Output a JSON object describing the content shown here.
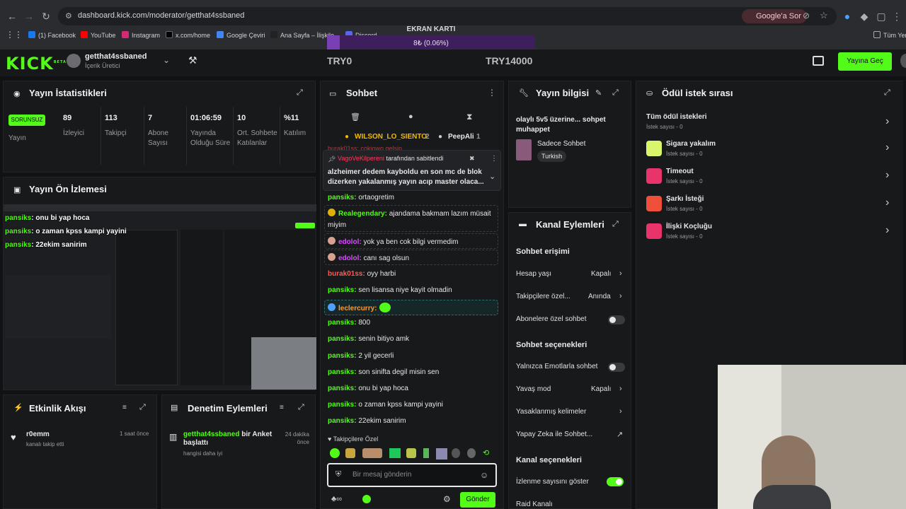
{
  "browser": {
    "url": "dashboard.kick.com/moderator/getthat4ssbaned",
    "google_chip": "Google'a Sor",
    "bookmarks": [
      "(1) Facebook",
      "YouTube",
      "Instagram",
      "x.com/home",
      "Google Çeviri",
      "Ana Sayfa – İlişkile...",
      "Discord",
      "Tüm Yer"
    ]
  },
  "overlay": {
    "card_title": "EKRAN KARTI",
    "progress_text": "8₺ (0.06%)",
    "progress_fraction": 0.0006,
    "left_amount": "TRY0",
    "right_amount": "TRY14000"
  },
  "header": {
    "logo": "KICK",
    "logo_beta": "BETA",
    "username": "getthat4ssbaned",
    "role": "İçerik Üretici",
    "go_live": "Yayına Geç"
  },
  "stats": {
    "title": "Yayın İstatistikleri",
    "status_badge": "SORUNSUZ",
    "status_label": "Yayın",
    "items": [
      {
        "value": "89",
        "label": "İzleyici"
      },
      {
        "value": "113",
        "label": "Takipçi"
      },
      {
        "value": "7",
        "label": "Abone Sayısı"
      },
      {
        "value": "01:06:59",
        "label": "Yayında Olduğu Süre"
      },
      {
        "value": "10",
        "label": "Ort. Sohbete Katılanlar"
      },
      {
        "value": "%11",
        "label": "Katılım"
      }
    ]
  },
  "preview": {
    "title": "Yayın Ön İzlemesi",
    "overlay_lines": [
      {
        "user": "pansiks",
        "text": ": onu bi yap hoca"
      },
      {
        "user": "pansiks",
        "text": ": o zaman kpss kampi yayini"
      },
      {
        "user": "pansiks",
        "text": ": 22ekim sanirim"
      }
    ]
  },
  "activity": {
    "title": "Etkinlik Akışı",
    "item_user": "r0emm",
    "item_text": "kanalı takip etti",
    "item_time": "1 saat önce"
  },
  "moderation": {
    "title": "Denetim Eylemleri",
    "item_user": "getthat4ssbaned",
    "item_action": " bir Anket başlattı",
    "item_sub": "hangisi daha iyi",
    "item_time": "24 dakika önce"
  },
  "chat": {
    "title": "Sohbet",
    "top_users": [
      {
        "name": "WILSON_LO_SIENTO",
        "count": "2"
      },
      {
        "name": "PeepAli",
        "count": "1"
      }
    ],
    "pinned_by": "VagoVeKilpereni",
    "pinned_suffix": " tarafından sabitlendi",
    "pinned_text": "alzheimer dedem kayboldu en son mc de blok dizerken yakalanmış yayın acıp master olaca...",
    "cut_line": "burak01ss: cokiowo gelsin",
    "messages": [
      {
        "user": "pansiks",
        "text": " ortaogretim"
      },
      {
        "user": "Realegendary",
        "text": " ajandama bakmam lazım müsait miyim"
      },
      {
        "user": "edolol",
        "text": " yok ya ben cok bilgi vermedim"
      },
      {
        "user": "edolol",
        "text": " canı sag olsun"
      },
      {
        "user": "burak01ss",
        "text": " oyy harbi"
      },
      {
        "user": "pansiks",
        "text": " sen lisansa niye kayit olmadin"
      },
      {
        "user": "leclercurry",
        "text": ""
      },
      {
        "user": "pansiks",
        "text": " 800"
      },
      {
        "user": "pansiks",
        "text": " senin bitiyo amk"
      },
      {
        "user": "pansiks",
        "text": " 2 yil gecerli"
      },
      {
        "user": "pansiks",
        "text": " son sinifta degil misin sen"
      },
      {
        "user": "pansiks",
        "text": " onu bi yap hoca"
      },
      {
        "user": "pansiks",
        "text": " o zaman kpss kampi yayini"
      },
      {
        "user": "pansiks",
        "text": " 22ekim sanirim"
      }
    ],
    "followers_only": "Takipçilere Özel",
    "input_placeholder": "Bir mesaj gönderin",
    "send": "Gönder"
  },
  "stream_info": {
    "title": "Yayın bilgisi",
    "stream_title": "olaylı 5v5 üzerine... sohpet muhappet",
    "category": "Sadece Sohbet",
    "language": "Turkish"
  },
  "channel_actions": {
    "title": "Kanal Eylemleri",
    "chat_access": "Sohbet erişimi",
    "account_age": "Hesap yaşı",
    "account_age_value": "Kapalı",
    "followers_only": "Takipçilere özel...",
    "followers_only_value": "Anında",
    "subs_only": "Abonelere özel sohbet",
    "chat_options": "Sohbet seçenekleri",
    "emotes_only": "Yalnızca Emotlarla sohbet",
    "slow_mode": "Yavaş mod",
    "slow_mode_value": "Kapalı",
    "banned_words": "Yasaklanmış kelimeler",
    "ai_chat": "Yapay Zeka ile Sohbet...",
    "channel_options": "Kanal seçenekleri",
    "show_viewers": "İzlenme sayısını göster",
    "raid": "Raid Kanalı"
  },
  "rewards": {
    "title": "Ödül istek sırası",
    "all_title": "Tüm ödül istekleri",
    "all_count": "İstek sayısı - 0",
    "items": [
      {
        "name": "Sigara yakalım",
        "count": "İstek sayısı - 0",
        "color": "#d9f56b"
      },
      {
        "name": "Timeout",
        "count": "İstek sayısı - 0",
        "color": "#e8336b"
      },
      {
        "name": "Şarkı İsteği",
        "count": "İstek sayısı - 0",
        "color": "#f0503a"
      },
      {
        "name": "İlişki Koçluğu",
        "count": "İstek sayısı - 0",
        "color": "#e8336b"
      }
    ]
  },
  "colors": {
    "accent": "#53fc18",
    "bg": "#111214",
    "panel": "#18191b",
    "progress": "#5b2a86"
  }
}
